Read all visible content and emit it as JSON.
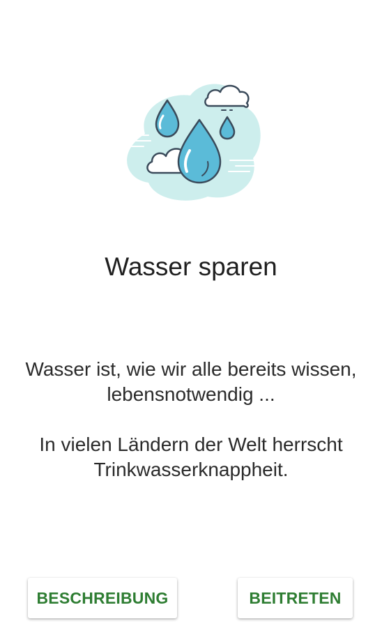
{
  "screen": {
    "illustration_icon": "water-drops-cloud-icon",
    "title": "Wasser sparen",
    "paragraphs": [
      "Wasser ist, wie wir alle bereits wissen, lebensnotwendig ...",
      "In vielen Ländern der Welt herrscht Trinkwasserknappheit."
    ]
  },
  "buttons": {
    "description_label": "BESCHREIBUNG",
    "join_label": "BEITRETEN"
  },
  "colors": {
    "accent": "#2e7d32",
    "drop_fill": "#5bbbd8",
    "drop_outline": "#3a4a5a",
    "background_blob": "#cdeeed"
  }
}
